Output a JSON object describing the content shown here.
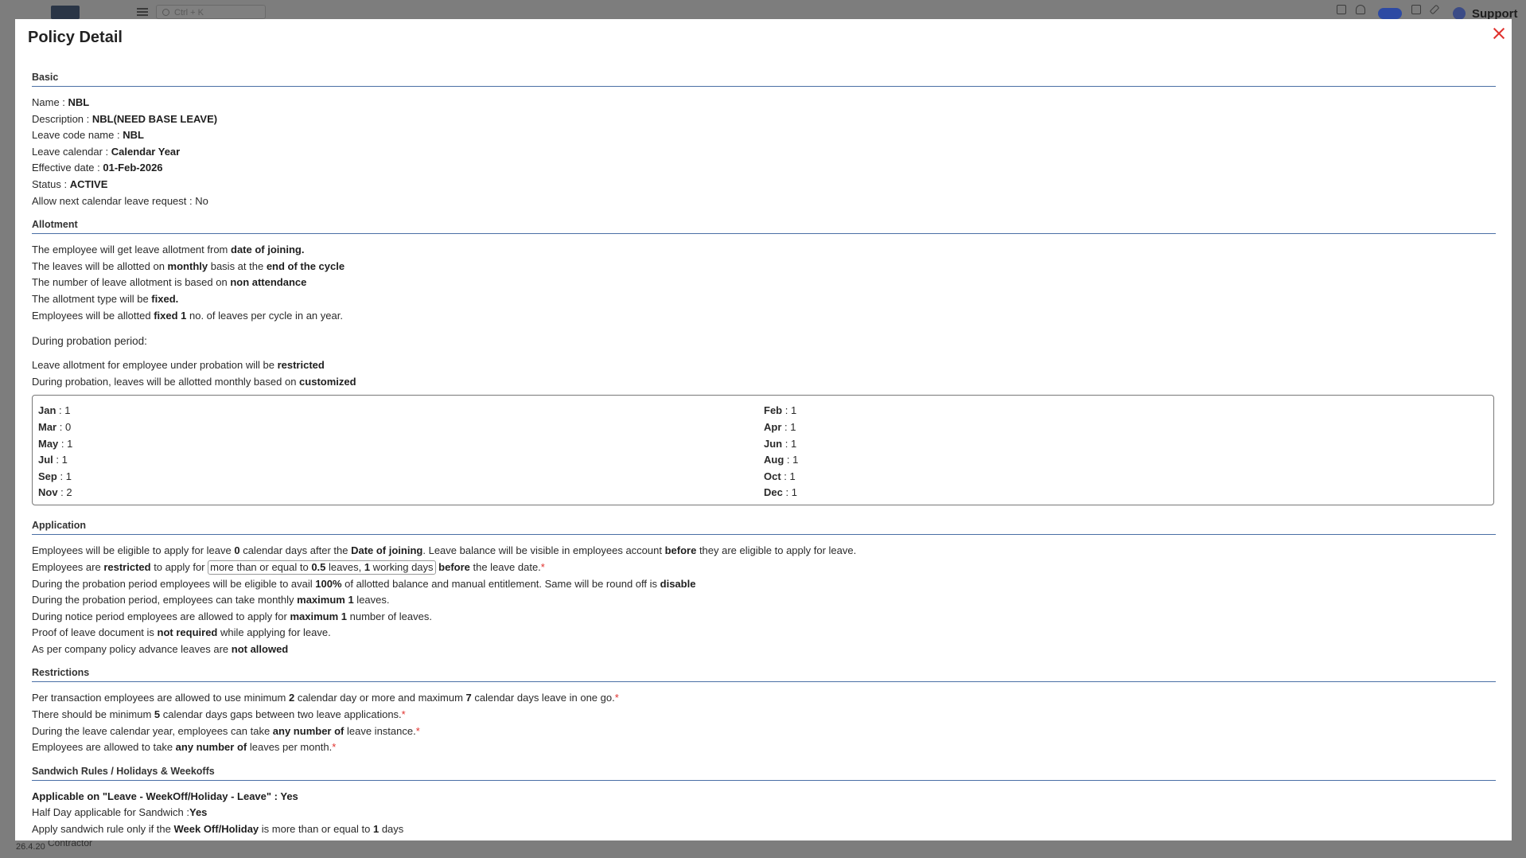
{
  "background": {
    "search_placeholder": "Ctrl + K",
    "support_label": "Support",
    "version": "26.4.20",
    "footer_text": "Contractor"
  },
  "modal": {
    "title": "Policy Detail",
    "close_icon": "close-icon"
  },
  "basic": {
    "heading": "Basic",
    "name_label": "Name : ",
    "name": "NBL",
    "description_label": "Description : ",
    "description": "NBL(NEED BASE LEAVE)",
    "leave_code_label": "Leave code name : ",
    "leave_code": "NBL",
    "leave_calendar_label": "Leave calendar : ",
    "leave_calendar": "Calendar Year",
    "effective_date_label": "Effective date : ",
    "effective_date": "01-Feb-2026",
    "status_label": "Status : ",
    "status": "ACTIVE",
    "allow_next_label": "Allow next calendar leave request : ",
    "allow_next": "No"
  },
  "allotment": {
    "heading": "Allotment",
    "l1_a": "The employee will get leave allotment from ",
    "l1_b": "date of joining.",
    "l2_a": "The leaves will be allotted on ",
    "l2_b": "monthly",
    "l2_c": " basis at the ",
    "l2_d": "end of the cycle",
    "l3_a": "The number of leave allotment is based on ",
    "l3_b": "non attendance",
    "l4_a": "The allotment type will be ",
    "l4_b": "fixed.",
    "l5_a": "Employees will be allotted ",
    "l5_b": "fixed 1",
    "l5_c": " no. of leaves per cycle in an year.",
    "probation_title": "During probation period:",
    "p1_a": "Leave allotment for employee under probation will be ",
    "p1_b": "restricted",
    "p2_a": "During probation, leaves will be allotted monthly based on ",
    "p2_b": "customized",
    "months_left": [
      {
        "m": "Jan",
        "v": "1"
      },
      {
        "m": "Mar",
        "v": "0"
      },
      {
        "m": "May",
        "v": "1"
      },
      {
        "m": "Jul",
        "v": "1"
      },
      {
        "m": "Sep",
        "v": "1"
      },
      {
        "m": "Nov",
        "v": "2"
      }
    ],
    "months_right": [
      {
        "m": "Feb",
        "v": "1"
      },
      {
        "m": "Apr",
        "v": "1"
      },
      {
        "m": "Jun",
        "v": "1"
      },
      {
        "m": "Aug",
        "v": "1"
      },
      {
        "m": "Oct",
        "v": "1"
      },
      {
        "m": "Dec",
        "v": "1"
      }
    ]
  },
  "application": {
    "heading": "Application",
    "a1_a": "Employees will be eligible to apply for leave ",
    "a1_b": "0",
    "a1_c": " calendar days after the ",
    "a1_d": "Date of joining",
    "a1_e": ". Leave balance will be visible in employees account ",
    "a1_f": "before",
    "a1_g": " they are eligible to apply for leave.",
    "a2_a": "Employees are ",
    "a2_b": "restricted",
    "a2_c": " to apply for ",
    "a2_p1": " more than or equal to ",
    "a2_p2": "0.5",
    "a2_p3": " leaves, ",
    "a2_p4": "1",
    "a2_p5": " working days ",
    "a2_d": " before",
    "a2_e": " the leave date.",
    "a2_req": "*",
    "a3_a": "During the probation period employees will be eligible to avail ",
    "a3_b": "100%",
    "a3_c": " of allotted balance and manual entitlement. Same will be round off is ",
    "a3_d": "disable",
    "a4_a": "During the probation period, employees can take monthly ",
    "a4_b": "maximum 1",
    "a4_c": " leaves.",
    "a5_a": "During notice period employees are allowed to apply for ",
    "a5_b": "maximum 1",
    "a5_c": " number of leaves.",
    "a6_a": "Proof of leave document is ",
    "a6_b": "not required",
    "a6_c": " while applying for leave.",
    "a7_a": "As per company policy advance leaves are ",
    "a7_b": "not allowed"
  },
  "restrictions": {
    "heading": "Restrictions",
    "r1_a": "Per transaction employees are allowed to use minimum ",
    "r1_b": "2",
    "r1_c": " calendar day or more and maximum ",
    "r1_d": "7",
    "r1_e": " calendar days leave in one go.",
    "r2_a": "There should be minimum ",
    "r2_b": "5",
    "r2_c": " calendar days gaps between two leave applications.",
    "r3_a": "During the leave calendar year, employees can take ",
    "r3_b": "any number of",
    "r3_c": " leave instance.",
    "r4_a": "Employees are allowed to take ",
    "r4_b": "any number of",
    "r4_c": " leaves per month.",
    "req": "*"
  },
  "sandwich": {
    "heading": "Sandwich Rules / Holidays & Weekoffs",
    "s1_a": "Applicable on \"Leave - WeekOff/Holiday - Leave\" : ",
    "s1_b": "Yes",
    "s2_a": "Half Day applicable for Sandwich :",
    "s2_b": "Yes",
    "s3_a": "Apply sandwich rule only if the ",
    "s3_b": "Week Off/Holiday",
    "s3_c": " is more than or equal to ",
    "s3_d": "1",
    "s3_e": " days"
  }
}
